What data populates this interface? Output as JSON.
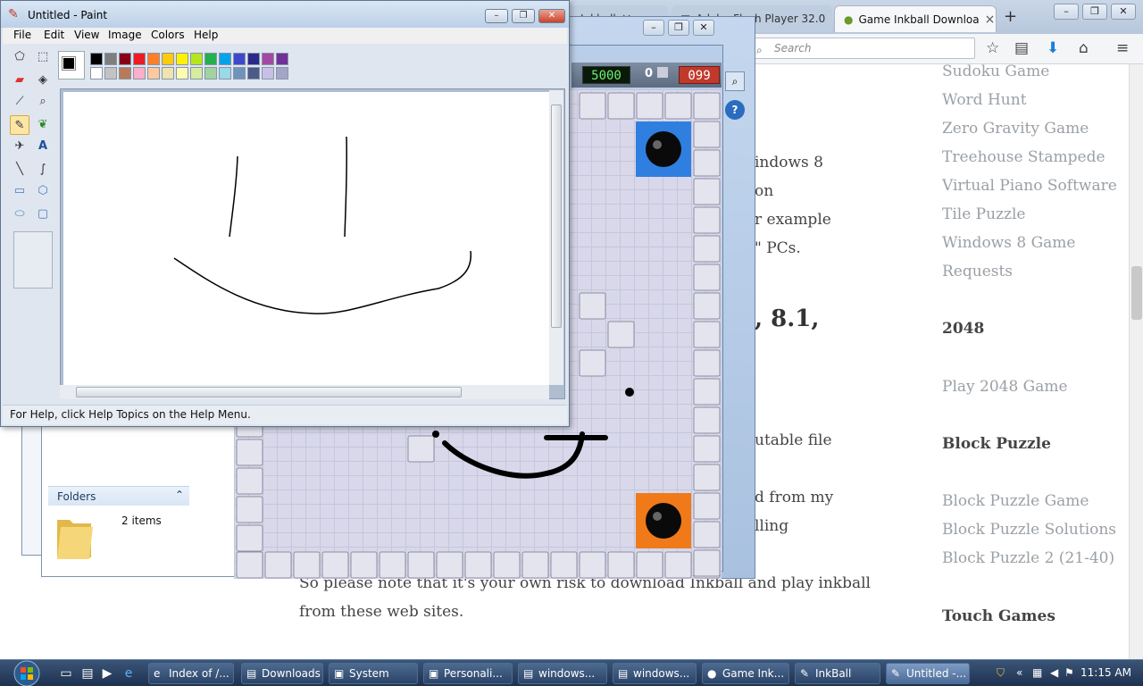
{
  "browser": {
    "tabs": [
      {
        "label": "Inkball"
      },
      {
        "label": "Adobe Flash Player 32.0"
      },
      {
        "label": "Game Inkball Downloa",
        "active": true
      }
    ],
    "search_placeholder": "Search",
    "article": {
      "lines": [
        "indows 8",
        "on",
        "r example",
        "\" PCs.",
        "utable file",
        "d from my",
        "lling"
      ],
      "heading": ", 8.1,",
      "bottom_lines": [
        "So please note that it's your own risk to download Inkball and play inkball",
        "from these web sites."
      ]
    },
    "sidebar": {
      "links_top": [
        "Sudoku Game",
        "Word Hunt",
        "Zero Gravity Game",
        "Treehouse Stampede",
        "Virtual Piano Software",
        "Tile Puzzle",
        "Windows 8 Game",
        "Requests"
      ],
      "head_2048": "2048",
      "link_2048": "Play 2048 Game",
      "head_block": "Block Puzzle",
      "links_block": [
        "Block Puzzle Game",
        "Block Puzzle Solutions",
        "Block Puzzle 2 (21-40)"
      ],
      "head_touch": "Touch Games"
    }
  },
  "explorer": {
    "folders_label": "Folders",
    "items_count": "2 items"
  },
  "inkball": {
    "score": "5000",
    "balls": "0",
    "time": "099",
    "colors": {
      "blue_hole": "#2f7fe0",
      "orange_hole": "#f07a1a"
    }
  },
  "paint": {
    "title": "Untitled - Paint",
    "menu": [
      "File",
      "Edit",
      "View",
      "Image",
      "Colors",
      "Help"
    ],
    "status": "For Help, click Help Topics on the Help Menu.",
    "palette_top": [
      "#000000",
      "#7f7f7f",
      "#880015",
      "#ed1c24",
      "#ff7f27",
      "#ffc90e",
      "#fff200",
      "#b5e61d",
      "#22b14c",
      "#00a2e8",
      "#3f48cc",
      "#2a2a8a",
      "#a349a4",
      "#6f3198"
    ],
    "palette_bottom": [
      "#ffffff",
      "#c3c3c3",
      "#b97a57",
      "#ffaec9",
      "#ffc9a0",
      "#efe4b0",
      "#fffbb0",
      "#d6eca0",
      "#a0d3a0",
      "#99d9ea",
      "#7092be",
      "#4b5a8a",
      "#c8bfe7",
      "#a5a5c8"
    ]
  },
  "taskbar": {
    "buttons": [
      {
        "label": "Index of /..."
      },
      {
        "label": "Downloads"
      },
      {
        "label": "System"
      },
      {
        "label": "Personali..."
      },
      {
        "label": "windows..."
      },
      {
        "label": "windows..."
      },
      {
        "label": "Game Ink..."
      },
      {
        "label": "InkBall"
      },
      {
        "label": "Untitled -...",
        "active": true
      }
    ],
    "clock": "11:15 AM"
  }
}
